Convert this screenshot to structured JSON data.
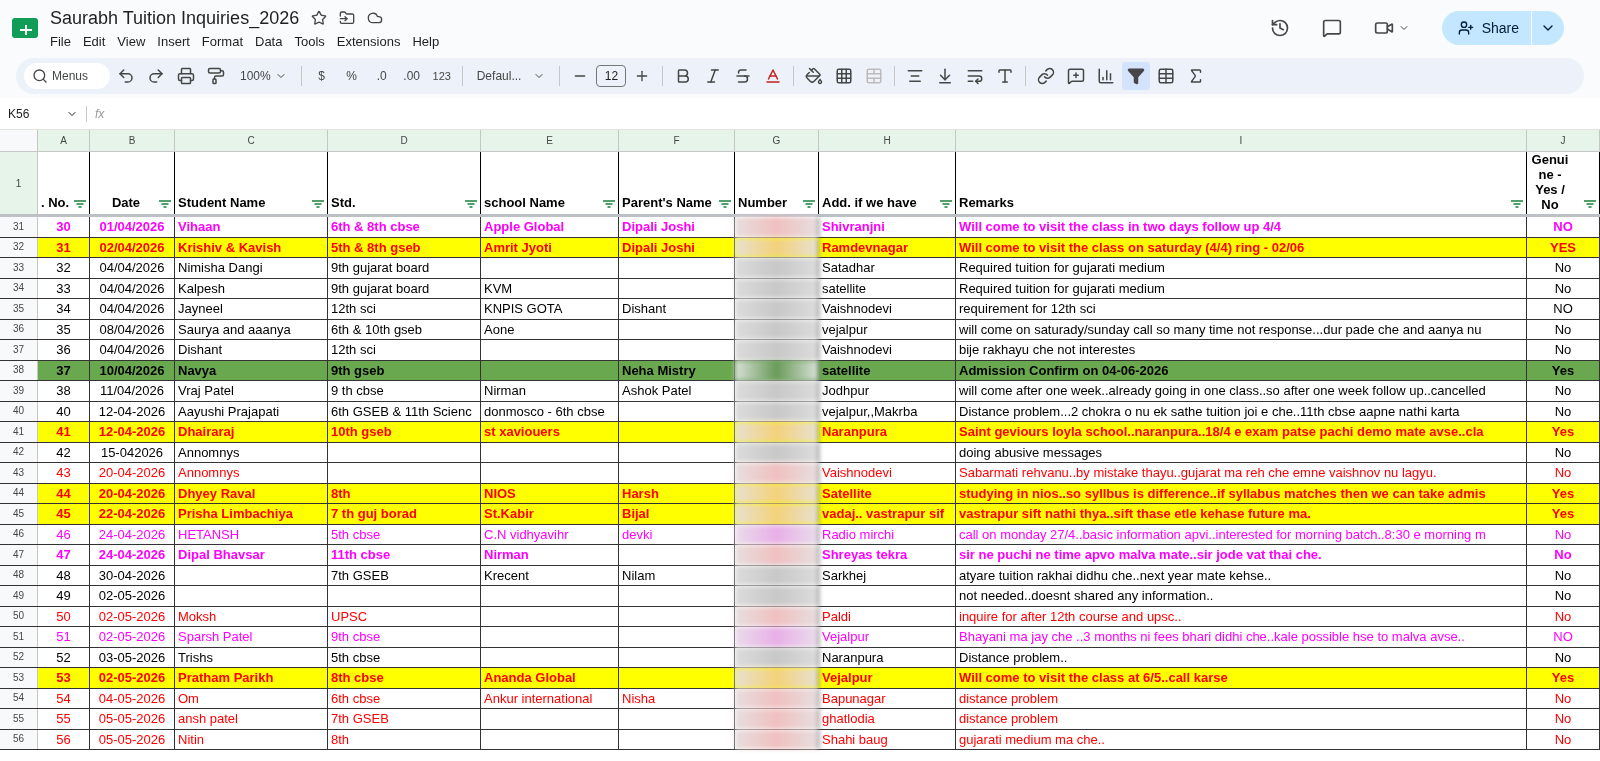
{
  "document": {
    "title": "Saurabh Tuition Inquiries_2026"
  },
  "menu": [
    "File",
    "Edit",
    "View",
    "Insert",
    "Format",
    "Data",
    "Tools",
    "Extensions",
    "Help"
  ],
  "share_button": "Share",
  "toolbar": {
    "search_placeholder": "Menus",
    "zoom": "100%",
    "currency": "$",
    "percent": "%",
    "decrease_decimals": ".0",
    "increase_decimals": ".00",
    "number_format": "123",
    "font": "Defaul...",
    "font_size": "12",
    "filter_on": true
  },
  "formula_bar": {
    "cell_ref": "K56",
    "fx": "fx"
  },
  "columns": [
    {
      "letter": "A",
      "header": ". No.",
      "kind": "text"
    },
    {
      "letter": "B",
      "header": "Date",
      "kind": "text"
    },
    {
      "letter": "C",
      "header": "Student Name",
      "kind": "text"
    },
    {
      "letter": "D",
      "header": "Std.",
      "kind": "text"
    },
    {
      "letter": "E",
      "header": "school Name",
      "kind": "text"
    },
    {
      "letter": "F",
      "header": "Parent's Name",
      "kind": "text"
    },
    {
      "letter": "G",
      "header": "Number",
      "kind": "blurred"
    },
    {
      "letter": "H",
      "header": "Add. if we have",
      "kind": "text"
    },
    {
      "letter": "I",
      "header": "Remarks",
      "kind": "text"
    },
    {
      "letter": "J",
      "header": "Genuine - Yes / No",
      "kind": "text"
    }
  ],
  "header_row_number": "1",
  "rows": [
    {
      "num": "31",
      "kind": "magenta_bold",
      "cells": [
        "30",
        "01/04/2026",
        "Vihaan",
        "6th & 8th cbse",
        "Apple Global",
        "Dipali Joshi",
        "Shivranjni",
        "Will come to visit the class in two days follow up 4/4",
        "NO"
      ]
    },
    {
      "num": "32",
      "kind": "yellow",
      "cells": [
        "31",
        "02/04/2026",
        "Krishiv & Kavish",
        "5th & 8th gseb",
        "Amrit Jyoti",
        "Dipali Joshi",
        "Ramdevnagar",
        "Will come to visit the class on saturday (4/4) ring - 02/06",
        "YES"
      ]
    },
    {
      "num": "33",
      "kind": "plain",
      "cells": [
        "32",
        "04/04/2026",
        "Nimisha Dangi",
        "9th gujarat board",
        null,
        null,
        "Satadhar",
        "Required tuition for gujarati medium",
        "No"
      ]
    },
    {
      "num": "34",
      "kind": "plain",
      "cells": [
        "33",
        "04/04/2026",
        "Kalpesh",
        "9th gujarat board",
        "KVM",
        null,
        "satellite",
        "Required tuition for gujarati medium",
        "No"
      ]
    },
    {
      "num": "35",
      "kind": "plain",
      "cells": [
        "34",
        "04/04/2026",
        "Jayneel",
        "12th  sci",
        "KNPIS GOTA",
        "Dishant",
        "Vaishnodevi",
        "requirement for 12th sci",
        "NO"
      ]
    },
    {
      "num": "36",
      "kind": "plain",
      "cells": [
        "35",
        "08/04/2026",
        "Saurya and aaanya",
        "6th & 10th gseb",
        "Aone",
        null,
        "vejalpur",
        "will come on saturady/sunday call so many time not response...dur pade che and aanya nu",
        "No"
      ]
    },
    {
      "num": "37",
      "kind": "plain",
      "cells": [
        "36",
        "04/04/2026",
        "Dishant",
        "12th sci",
        null,
        null,
        "Vaishnodevi",
        "bije rakhayu che not interestes",
        "No"
      ]
    },
    {
      "num": "38",
      "kind": "green",
      "cells": [
        "37",
        "10/04/2026",
        "Navya",
        "9th gseb",
        null,
        "Neha Mistry",
        "satellite",
        "Admission Confirm on 04-06-2026",
        "Yes"
      ]
    },
    {
      "num": "39",
      "kind": "plain",
      "cells": [
        "38",
        "11/04/2026",
        "Vraj Patel",
        "9 th cbse",
        "Nirman",
        "Ashok Patel",
        "Jodhpur",
        "will come after one week..already going in one class..so after one week follow up..cancelled",
        "No"
      ]
    },
    {
      "num": "40",
      "kind": "plain",
      "cells": [
        "40",
        "12-04-2026",
        "Aayushi Prajapati",
        "6th GSEB & 11th Scienc",
        "donmosco - 6th cbse",
        null,
        "vejalpur,,Makrba",
        "Distance problem...2 chokra o nu ek sathe tuition joi e che..11th cbse aapne nathi karta",
        "No"
      ]
    },
    {
      "num": "41",
      "kind": "yellow",
      "cells": [
        "41",
        "12-04-2026",
        "Dhairaraj",
        "10th gseb",
        "st xaviouers",
        null,
        "Naranpura",
        "Saint geviours loyla school..naranpura..18/4 e exam patse pachi demo mate avse..cla",
        "Yes"
      ]
    },
    {
      "num": "42",
      "kind": "plain",
      "cells": [
        "42",
        "15-042026",
        "Annomnys",
        null,
        null,
        null,
        null,
        "doing abusive messages",
        "No"
      ]
    },
    {
      "num": "43",
      "kind": "red",
      "cells": [
        "43",
        "20-04-2026",
        "Annomnys",
        null,
        null,
        null,
        "Vaishnodevi",
        "Sabarmati rehvanu..by mistake thayu..gujarat ma reh che emne vaishnov nu lagyu.",
        "No"
      ]
    },
    {
      "num": "44",
      "kind": "yellow",
      "cells": [
        "44",
        "20-04-2026",
        "Dhyey Raval",
        "8th",
        "NIOS",
        "Harsh",
        "Satellite",
        "studying in nios..so syllbus is difference..if syllabus matches then we can take admis",
        "Yes"
      ]
    },
    {
      "num": "45",
      "kind": "yellow",
      "cells": [
        "45",
        "22-04-2026",
        "Prisha Limbachiya",
        "7 th guj borad",
        "St.Kabir",
        "Bijal",
        "vadaj.. vastrapur sif",
        "vastrapur sift nathi thya..sift thase etle kehase future ma.",
        "Yes"
      ]
    },
    {
      "num": "46",
      "kind": "magenta",
      "cells": [
        "46",
        "24-04-2026",
        "HETANSH",
        "5th cbse",
        "C.N vidhyavihr",
        "devki",
        "Radio mirchi",
        "call on monday 27/4..basic information apvi..interested for morning batch..8:30 e morning m",
        "No"
      ]
    },
    {
      "num": "47",
      "kind": "magenta_bold",
      "cells": [
        "47",
        "24-04-2026",
        "Dipal Bhavsar",
        "11th cbse",
        "Nirman",
        null,
        "Shreyas tekra",
        "sir ne puchi ne time apvo malva mate..sir jode vat thai che.",
        "No"
      ]
    },
    {
      "num": "48",
      "kind": "plain",
      "cells": [
        "48",
        "30-04-2026",
        null,
        "7th GSEB",
        "Krecent",
        "Nilam",
        "Sarkhej",
        "atyare tuition rakhai didhu che..next year mate kehse..",
        "No"
      ]
    },
    {
      "num": "49",
      "kind": "plain",
      "cells": [
        "49",
        "02-05-2026",
        null,
        null,
        null,
        null,
        null,
        "not needed..doesnt shared any information..",
        "No"
      ]
    },
    {
      "num": "50",
      "kind": "red",
      "cells": [
        "50",
        "02-05-2026",
        "Moksh",
        "UPSC",
        null,
        null,
        "Paldi",
        "inquire for after 12th course and upsc..",
        "No"
      ]
    },
    {
      "num": "51",
      "kind": "magenta",
      "cells": [
        "51",
        "02-05-2026",
        "Sparsh Patel",
        "9th cbse",
        null,
        null,
        "Vejalpur",
        "Bhayani ma jay che ..3 months ni fees bhari didhi che..kale possible hse to malva avse..",
        "NO"
      ]
    },
    {
      "num": "52",
      "kind": "plain",
      "cells": [
        "52",
        "03-05-2026",
        "Trishs",
        "5th cbse",
        null,
        null,
        "Naranpura",
        "Distance problem..",
        "No"
      ]
    },
    {
      "num": "53",
      "kind": "yellow",
      "cells": [
        "53",
        "02-05-2026",
        "Pratham Parikh",
        "8th cbse",
        "Ananda Global",
        null,
        "Vejalpur",
        "Will come to visit the class at 6/5..call karse",
        "Yes"
      ]
    },
    {
      "num": "54",
      "kind": "red",
      "cells": [
        "54",
        "04-05-2026",
        "Om",
        "6th cbse",
        "Ankur international",
        "Nisha",
        "Bapunagar",
        "distance problem",
        "No"
      ]
    },
    {
      "num": "55",
      "kind": "red",
      "cells": [
        "55",
        "05-05-2026",
        "ansh patel",
        "7th GSEB",
        null,
        null,
        "ghatlodia",
        "distance problem",
        "No"
      ]
    },
    {
      "num": "56",
      "kind": "red",
      "cells": [
        "56",
        "05-05-2026",
        "Nitin",
        "8th",
        null,
        null,
        "Shahi baug",
        "gujarati medium ma che..",
        "No"
      ]
    }
  ]
}
